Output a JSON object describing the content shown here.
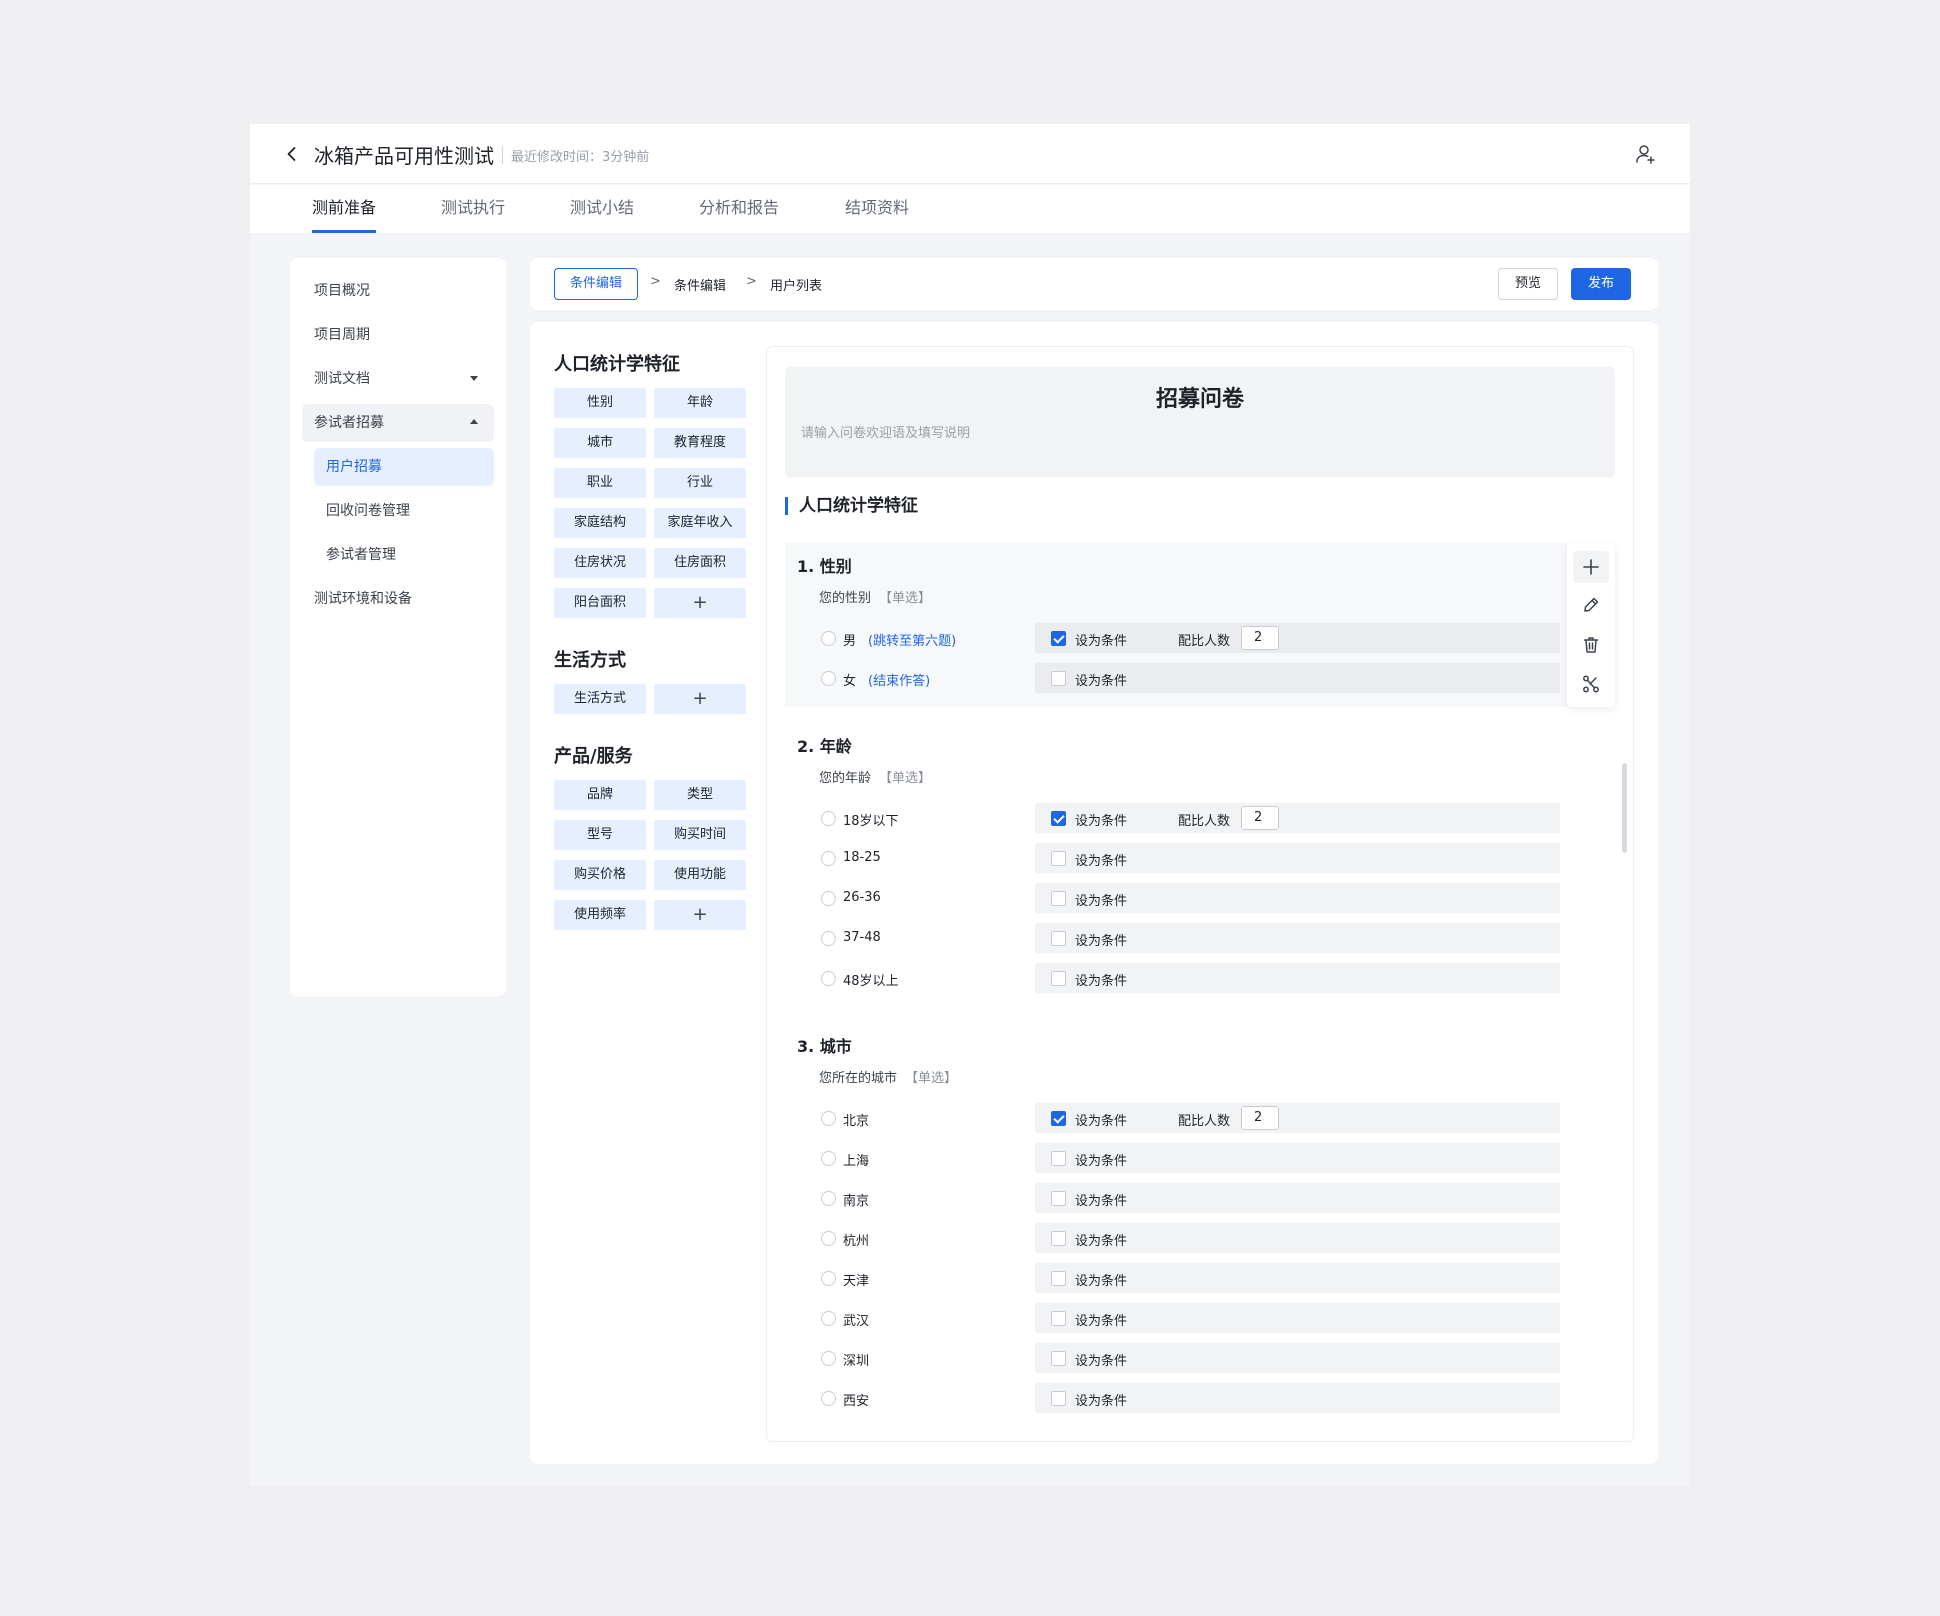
{
  "header": {
    "title": "冰箱产品可用性测试",
    "modified": "最近修改时间：3分钟前"
  },
  "tabs": [
    "测前准备",
    "测试执行",
    "测试小结",
    "分析和报告",
    "结项资料"
  ],
  "sidenav": {
    "items": [
      "项目概况",
      "项目周期",
      "测试文档",
      "参试者招募"
    ],
    "sub_items": [
      "用户招募",
      "回收问卷管理",
      "参试者管理"
    ],
    "last": "测试环境和设备"
  },
  "breadcrumb": {
    "current": "条件编辑",
    "sep": ">",
    "items": [
      "条件编辑",
      "用户列表"
    ]
  },
  "actions": {
    "preview": "预览",
    "publish": "发布"
  },
  "library": {
    "groups": [
      {
        "title": "人口统计学特征",
        "chips": [
          "性别",
          "年龄",
          "城市",
          "教育程度",
          "职业",
          "行业",
          "家庭结构",
          "家庭年收入",
          "住房状况",
          "住房面积",
          "阳台面积",
          "+"
        ]
      },
      {
        "title": "生活方式",
        "chips": [
          "生活方式",
          "+"
        ]
      },
      {
        "title": "产品/服务",
        "chips": [
          "品牌",
          "类型",
          "型号",
          "购买时间",
          "购买价格",
          "使用功能",
          "使用频率",
          "+"
        ]
      }
    ]
  },
  "survey": {
    "title": "招募问卷",
    "description": "请输入问卷欢迎语及填写说明",
    "section": "人口统计学特征",
    "condition_label": "设为条件",
    "ratio_label": "配比人数",
    "questions": [
      {
        "title": "1.  性别",
        "subtitle": "您的性别",
        "type": "【单选】",
        "options": [
          {
            "label": "男",
            "link": "(跳转至第六题)",
            "checked": true,
            "ratio": "2"
          },
          {
            "label": "女",
            "link": "(结束作答)",
            "checked": false
          }
        ]
      },
      {
        "title": "2.  年龄",
        "subtitle": "您的年龄",
        "type": "【单选】",
        "options": [
          {
            "label": "18岁以下",
            "checked": true,
            "ratio": "2"
          },
          {
            "label": "18-25",
            "checked": false
          },
          {
            "label": "26-36",
            "checked": false
          },
          {
            "label": "37-48",
            "checked": false
          },
          {
            "label": "48岁以上",
            "checked": false
          }
        ]
      },
      {
        "title": "3.  城市",
        "subtitle": "您所在的城市",
        "type": "【单选】",
        "options": [
          {
            "label": "北京",
            "checked": true,
            "ratio": "2"
          },
          {
            "label": "上海",
            "checked": false
          },
          {
            "label": "南京",
            "checked": false
          },
          {
            "label": "杭州",
            "checked": false
          },
          {
            "label": "天津",
            "checked": false
          },
          {
            "label": "武汉",
            "checked": false
          },
          {
            "label": "深圳",
            "checked": false
          },
          {
            "label": "西安",
            "checked": false
          }
        ]
      }
    ]
  },
  "toolbar_icons": [
    "plus-icon",
    "edit-icon",
    "trash-icon",
    "branch-icon"
  ],
  "colors": {
    "accent": "#1f66e5",
    "chip_bg": "#e6efff"
  }
}
